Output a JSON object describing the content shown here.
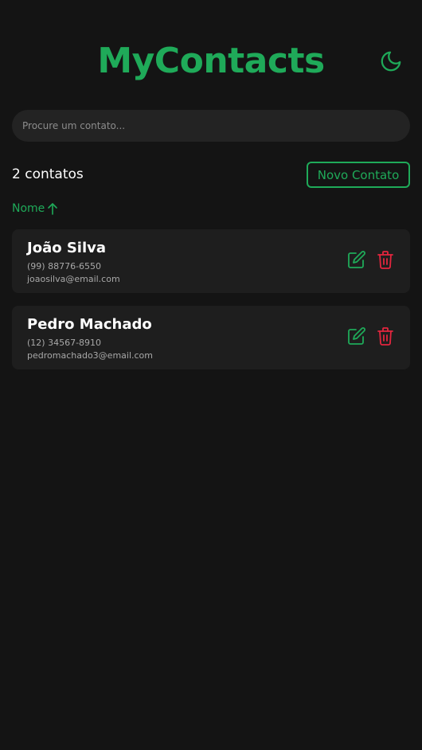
{
  "app": {
    "title": "MyContacts",
    "theme_icon": "moon-icon"
  },
  "colors": {
    "accent": "#1faa59",
    "danger": "#e3263e",
    "background": "#141414",
    "card": "#1e1e1e",
    "input": "#232323"
  },
  "search": {
    "placeholder": "Procure um contato...",
    "value": ""
  },
  "toolbar": {
    "count_label": "2 contatos",
    "new_contact_label": "Novo Contato"
  },
  "sort": {
    "label": "Nome",
    "direction_icon": "arrow-up-icon"
  },
  "contacts": [
    {
      "name": "João Silva",
      "phone": "(99) 88776-6550",
      "email": "joaosilva@email.com",
      "edit_icon": "edit-icon",
      "delete_icon": "trash-icon"
    },
    {
      "name": "Pedro Machado",
      "phone": "(12) 34567-8910",
      "email": "pedromachado3@email.com",
      "edit_icon": "edit-icon",
      "delete_icon": "trash-icon"
    }
  ]
}
